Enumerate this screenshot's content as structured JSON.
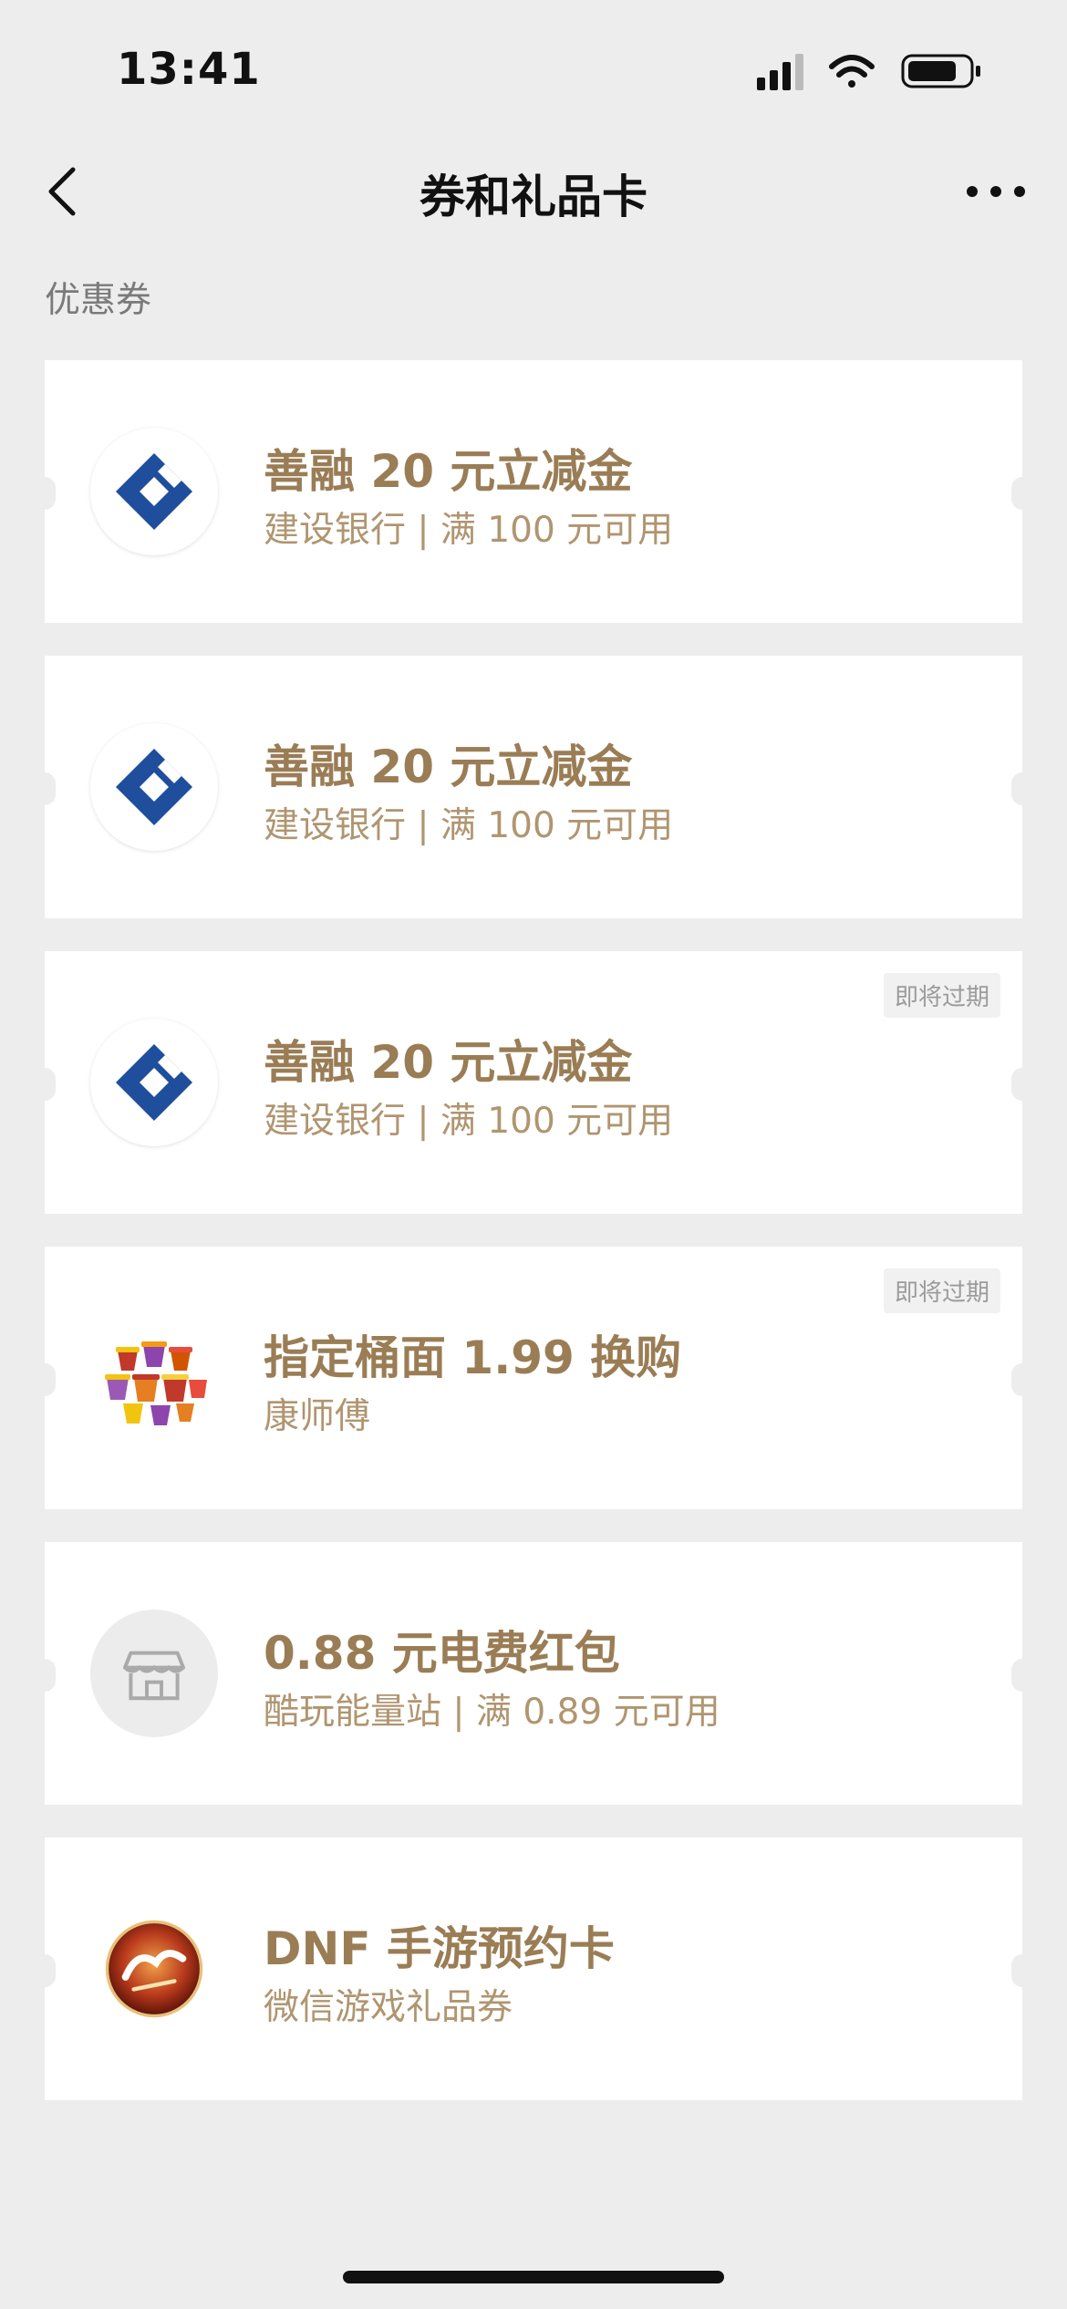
{
  "status": {
    "time": "13:41"
  },
  "nav": {
    "title": "券和礼品卡"
  },
  "section": {
    "label": "优惠券"
  },
  "colors": {
    "accent_gold": "#9a7d55",
    "ccb_blue": "#1f4e9c",
    "background": "#ededed"
  },
  "coupons": [
    {
      "title": "善融 20 元立减金",
      "subtitle": "建设银行 | 满 100 元可用",
      "logo": "ccb-logo-icon",
      "badge": ""
    },
    {
      "title": "善融 20 元立减金",
      "subtitle": "建设银行 | 满 100 元可用",
      "logo": "ccb-logo-icon",
      "badge": ""
    },
    {
      "title": "善融 20 元立减金",
      "subtitle": "建设银行 | 满 100 元可用",
      "logo": "ccb-logo-icon",
      "badge": "即将过期"
    },
    {
      "title": "指定桶面 1.99 换购",
      "subtitle": "康师傅",
      "logo": "noodle-cups-icon",
      "badge": "即将过期"
    },
    {
      "title": "0.88 元电费红包",
      "subtitle": "酷玩能量站 | 满 0.89 元可用",
      "logo": "store-icon",
      "badge": ""
    },
    {
      "title": "DNF 手游预约卡",
      "subtitle": "微信游戏礼品券",
      "logo": "dnf-game-icon",
      "badge": ""
    }
  ]
}
